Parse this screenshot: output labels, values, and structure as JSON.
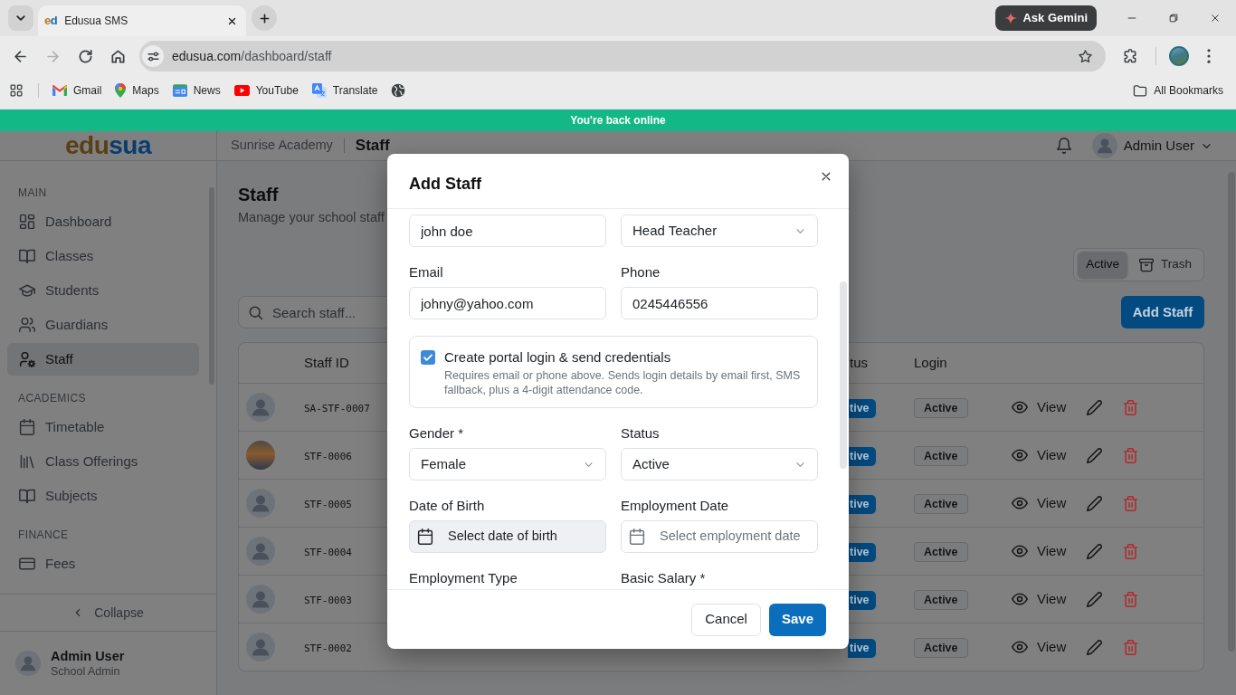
{
  "browser": {
    "tabs": [
      {
        "favicon": {
          "first": "e",
          "second": "d"
        },
        "title": "Edusua SMS",
        "selected": true
      }
    ],
    "ask_button": "Ask Gemini",
    "nav": [
      {
        "disabled": false
      },
      {
        "disabled": true
      },
      {
        "disabled": false
      },
      {
        "disabled": false
      }
    ],
    "url": {
      "host": "edusua.com",
      "path": "/dashboard/staff"
    },
    "bookmarks": [
      {
        "label": "Gmail"
      },
      {
        "label": "Maps"
      },
      {
        "label": "News"
      },
      {
        "label": "YouTube"
      },
      {
        "label": "Translate"
      }
    ],
    "all_bookmarks": "All Bookmarks"
  },
  "banner": {
    "text": "You're back online"
  },
  "app": {
    "logo": {
      "first": "edu",
      "second": "sua"
    },
    "header": {
      "school": "Sunrise Academy",
      "page": "Staff",
      "user": "Admin User"
    },
    "sidebar": {
      "sections": [
        {
          "heading": "MAIN",
          "items": [
            {
              "label": "Dashboard",
              "selected": false
            },
            {
              "label": "Classes",
              "selected": false
            },
            {
              "label": "Students",
              "selected": false
            },
            {
              "label": "Guardians",
              "selected": false
            },
            {
              "label": "Staff",
              "selected": true
            }
          ]
        },
        {
          "heading": "ACADEMICS",
          "items": [
            {
              "label": "Timetable",
              "selected": false
            },
            {
              "label": "Class Offerings",
              "selected": false
            },
            {
              "label": "Subjects",
              "selected": false
            }
          ]
        },
        {
          "heading": "FINANCE",
          "items": [
            {
              "label": "Fees",
              "selected": false
            }
          ]
        }
      ],
      "collapse": "Collapse",
      "user": {
        "name": "Admin User",
        "role": "School Admin"
      }
    },
    "page": {
      "title": "Staff",
      "subtitle": "Manage your school staff",
      "view_tabs": [
        {
          "label": "Active",
          "selected": true
        },
        {
          "label": "Trash",
          "selected": false
        }
      ],
      "search": {
        "placeholder": "Search staff..."
      },
      "add_button": "Add Staff",
      "table": {
        "columns": [
          "Staff ID",
          "tus",
          "Login"
        ],
        "rows": [
          {
            "photo": false,
            "staff_id": "SA-STF-0007",
            "status": "tive",
            "login": "Active",
            "view": "View"
          },
          {
            "photo": true,
            "staff_id": "STF-0006",
            "status": "tive",
            "login": "Active",
            "view": "View"
          },
          {
            "photo": false,
            "staff_id": "STF-0005",
            "status": "tive",
            "login": "Active",
            "view": "View"
          },
          {
            "photo": false,
            "staff_id": "STF-0004",
            "status": "tive",
            "login": "Active",
            "view": "View"
          },
          {
            "photo": false,
            "staff_id": "STF-0003",
            "status": "tive",
            "login": "Active",
            "view": "View"
          },
          {
            "photo": false,
            "staff_id": "STF-0002",
            "status": "tive",
            "login": "Active",
            "view": "View"
          }
        ]
      }
    }
  },
  "modal": {
    "title": "Add Staff",
    "fields": [
      {
        "kind": "input",
        "value": "john doe"
      },
      {
        "kind": "select",
        "value": "Head Teacher"
      },
      {
        "kind": "input",
        "label": "Email",
        "value": "johny@yahoo.com"
      },
      {
        "kind": "input",
        "label": "Phone",
        "value": "0245446556"
      },
      {
        "kind": "checkbox",
        "checked": true,
        "title": "Create portal login & send credentials",
        "help": "Requires email or phone above. Sends login details by email first, SMS fallback, plus a 4-digit attendance code."
      },
      {
        "kind": "select",
        "label": "Gender *",
        "value": "Female"
      },
      {
        "kind": "select",
        "label": "Status",
        "value": "Active"
      },
      {
        "kind": "date",
        "label": "Date of Birth",
        "placeholder": "Select date of birth",
        "active": true
      },
      {
        "kind": "date",
        "label": "Employment Date",
        "placeholder": "Select employment date",
        "active": false
      },
      {
        "kind": "label",
        "label": "Employment Type"
      },
      {
        "kind": "label",
        "label": "Basic Salary *"
      }
    ],
    "buttons": [
      {
        "label": "Cancel",
        "kind": "secondary"
      },
      {
        "label": "Save",
        "kind": "primary"
      }
    ]
  }
}
